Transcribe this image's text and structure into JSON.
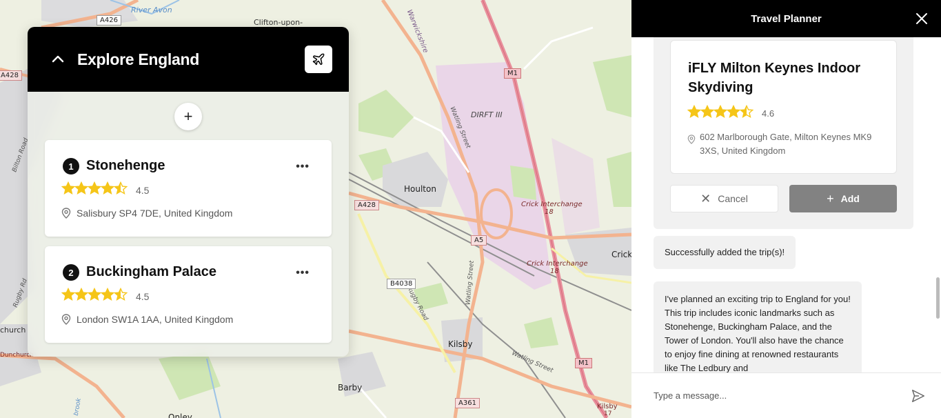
{
  "map": {
    "labels": {
      "clifton": "Clifton-upon-",
      "river_avon": "River Avon",
      "warwickshire": "Warwickshire",
      "dirft": "DIRFT III",
      "houlton": "Houlton",
      "crick1": "Crick Interchange",
      "crick1_num": "18",
      "crick2": "Crick Interchange",
      "crick2_num": "18",
      "watling1": "Watling Street",
      "watling2": "Watling Street",
      "watling3": "Watling Street",
      "rugby_road": "Rugby Road",
      "kilsby": "Kilsby",
      "barby": "Barby",
      "onley": "Onley",
      "crick": "Crick",
      "dunchurch": "Dunchurch",
      "bilton": "Bilton Road",
      "rugby_rd": "Rugby Rd",
      "kilsby_bottom": "Kilsby",
      "n17": "17",
      "church": "church",
      "brook": "brook"
    },
    "shields": {
      "a426": "A426",
      "a428_left": "A428",
      "a428_mid": "A428",
      "m1_top": "M1",
      "m1_bottom": "M1",
      "a5": "A5",
      "b4038": "B4038",
      "a361": "A361"
    }
  },
  "explore": {
    "title": "Explore England",
    "places": [
      {
        "num": "1",
        "name": "Stonehenge",
        "rating": "4.5",
        "stars": 4.5,
        "address": "Salisbury SP4 7DE, United Kingdom"
      },
      {
        "num": "2",
        "name": "Buckingham Palace",
        "rating": "4.5",
        "stars": 4.5,
        "address": "London SW1A 1AA, United Kingdom"
      }
    ]
  },
  "planner": {
    "title": "Travel Planner",
    "suggestion": {
      "name": "iFLY Milton Keynes Indoor Skydiving",
      "rating": "4.6",
      "stars": 4.6,
      "address": "602 Marlborough Gate, Milton Keynes MK9 3XS, United Kingdom",
      "cancel_label": "Cancel",
      "add_label": "Add"
    },
    "messages": {
      "success": "Successfully added the trip(s)!",
      "summary": "I've planned an exciting trip to England for you! This trip includes iconic landmarks such as Stonehenge, Buckingham Palace, and the Tower of London. You'll also have the chance to enjoy fine dining at renowned restaurants like The Ledbury and"
    },
    "composer": {
      "placeholder": "Type a message..."
    }
  },
  "colors": {
    "header_bg": "#000000",
    "star": "#f5c518",
    "add_button": "#828282",
    "motorway": "#e8909c",
    "primary_road": "#f0a080",
    "industrial": "#ead6e8",
    "land": "#eef0e2",
    "green": "#cfe6b4"
  }
}
